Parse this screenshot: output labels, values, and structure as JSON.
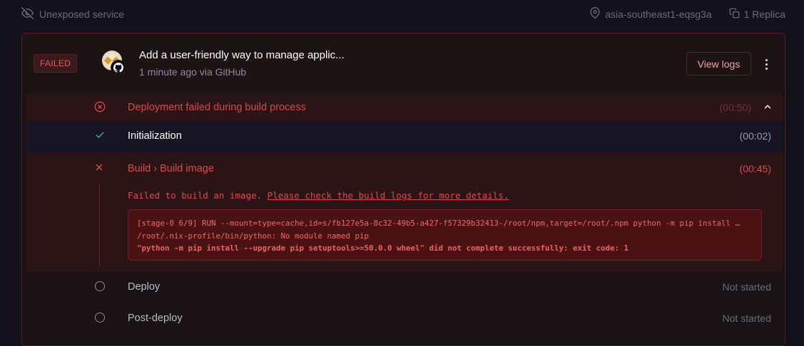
{
  "topbar": {
    "exposure_label": "Unexposed service",
    "region_label": "asia-southeast1-eqsg3a",
    "replica_label": "1 Replica"
  },
  "deployment": {
    "status_badge": "FAILED",
    "commit_title": "Add a user-friendly way to manage applic...",
    "commit_meta": "1 minute ago via GitHub",
    "view_logs_label": "View logs",
    "summary": {
      "label": "Deployment failed during build process",
      "time": "(00:50)"
    },
    "steps": {
      "initialization": {
        "label": "Initialization",
        "time": "(00:02)"
      },
      "build": {
        "label": "Build › Build image",
        "time": "(00:45)",
        "error_prefix": "Failed to build an image. ",
        "error_link": "Please check the build logs for more details.",
        "log_lines": [
          "[stage-0 6/9] RUN --mount=type=cache,id=s/fb127e5a-8c32-49b5-a427-f57329b32413-/root/npm,target=/root/.npm python -m pip install …",
          "/root/.nix-profile/bin/python: No module named pip",
          "\"python -m pip install --upgrade pip setuptools>=50.0.0 wheel\" did not complete successfully: exit code: 1"
        ]
      },
      "deploy": {
        "label": "Deploy",
        "time": "Not started"
      },
      "post_deploy": {
        "label": "Post-deploy",
        "time": "Not started"
      }
    }
  },
  "colors": {
    "error": "#e0484d",
    "success": "#3fb58a",
    "background": "#13111c"
  },
  "icons": {
    "exposure": "eye-off-icon",
    "region": "location-pin-icon",
    "replica": "copy-icon",
    "summary": "x-circle-icon",
    "initialization": "check-icon",
    "build": "x-icon",
    "pending": "circle-icon"
  }
}
